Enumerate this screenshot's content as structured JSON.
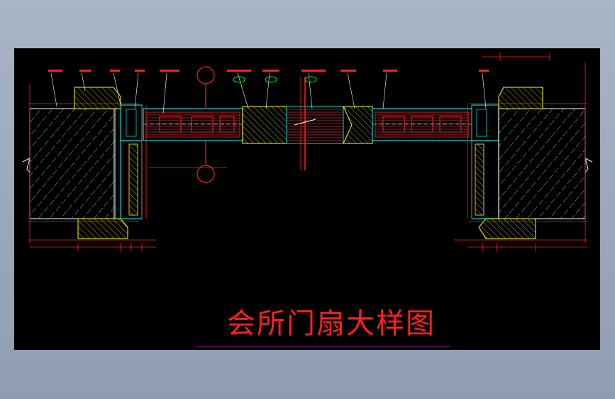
{
  "drawing": {
    "title": "会所门扇大样图"
  },
  "colors": {
    "background": "#000000",
    "frame": "#00d8d8",
    "dimension": "#ff2020",
    "fill": "#c0c0c0",
    "accent": "#ffff00",
    "green": "#00ff00",
    "title": "#ff2020",
    "underline": "#c000c0"
  }
}
